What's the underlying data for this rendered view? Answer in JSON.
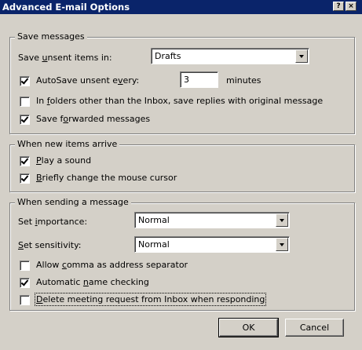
{
  "window": {
    "title": "Advanced E-mail Options",
    "help_button": "?",
    "close_button": "×"
  },
  "save_messages": {
    "legend": "Save messages",
    "save_unsent_label_pre": "Save ",
    "save_unsent_label_u": "u",
    "save_unsent_label_post": "nsent items in:",
    "save_unsent_value": "Drafts",
    "autosave_checked": true,
    "autosave_label_pre": "AutoSave unsent e",
    "autosave_label_u": "v",
    "autosave_label_post": "ery:",
    "autosave_minutes": "3",
    "minutes_label": "minutes",
    "in_folders_checked": false,
    "in_folders_label_pre": "In ",
    "in_folders_label_u": "f",
    "in_folders_label_post": "olders other than the Inbox, save replies with original message",
    "save_forwarded_checked": true,
    "save_forwarded_label_pre": "Save f",
    "save_forwarded_label_u": "o",
    "save_forwarded_label_post": "rwarded messages"
  },
  "new_items": {
    "legend": "When new items arrive",
    "play_sound_checked": true,
    "play_sound_label_u": "P",
    "play_sound_label_post": "lay a sound",
    "change_cursor_checked": true,
    "change_cursor_label_u": "B",
    "change_cursor_label_post": "riefly change the mouse cursor"
  },
  "sending": {
    "legend": "When sending a message",
    "importance_label_pre": "Set ",
    "importance_label_u": "i",
    "importance_label_post": "mportance:",
    "importance_value": "Normal",
    "sensitivity_label_u": "S",
    "sensitivity_label_post": "et sensitivity:",
    "sensitivity_value": "Normal",
    "comma_checked": false,
    "comma_label_pre": "Allow ",
    "comma_label_u": "c",
    "comma_label_post": "omma as address separator",
    "name_check_checked": true,
    "name_check_label_pre": "Automatic ",
    "name_check_label_u": "n",
    "name_check_label_post": "ame checking",
    "delete_meeting_checked": false,
    "delete_meeting_label_u": "D",
    "delete_meeting_label_post": "elete meeting request from Inbox when responding"
  },
  "buttons": {
    "ok": "OK",
    "cancel": "Cancel"
  }
}
